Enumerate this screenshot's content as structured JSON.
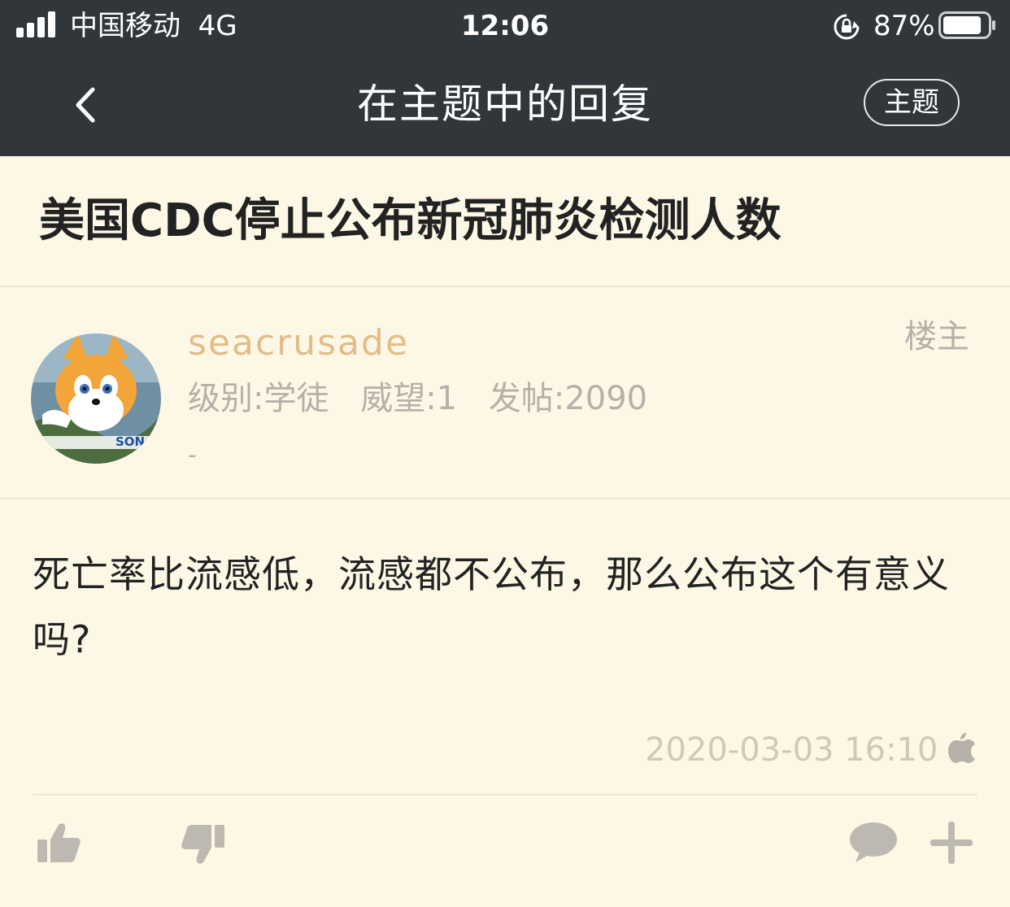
{
  "status_bar": {
    "carrier": "中国移动",
    "network": "4G",
    "time": "12:06",
    "battery_percent": "87%",
    "battery_level": 0.87
  },
  "nav": {
    "title": "在主题中的回复",
    "topic_button_label": "主题",
    "back_icon": "chevron-left-icon"
  },
  "thread": {
    "title": "美国CDC停止公布新冠肺炎检测人数"
  },
  "post": {
    "username": "seacrusade",
    "level": "级别:学徒",
    "reputation": "威望:1",
    "post_count": "发帖:2090",
    "extra": "-",
    "floor_label": "楼主",
    "content": "死亡率比流感低，流感都不公布，那么公布这个有意义吗?",
    "timestamp": "2020-03-03 16:10",
    "device_icon": "apple-icon",
    "avatar_text": "SON"
  },
  "actions": {
    "like_icon": "thumbs-up-icon",
    "dislike_icon": "thumbs-down-icon",
    "comment_icon": "comment-icon",
    "more_icon": "plus-icon"
  },
  "colors": {
    "bar_background": "#31363a",
    "page_background": "#fdf8e6",
    "username": "#e2bd87",
    "meta_text": "#b5b1a8",
    "action_icon": "#bdb9b0"
  }
}
